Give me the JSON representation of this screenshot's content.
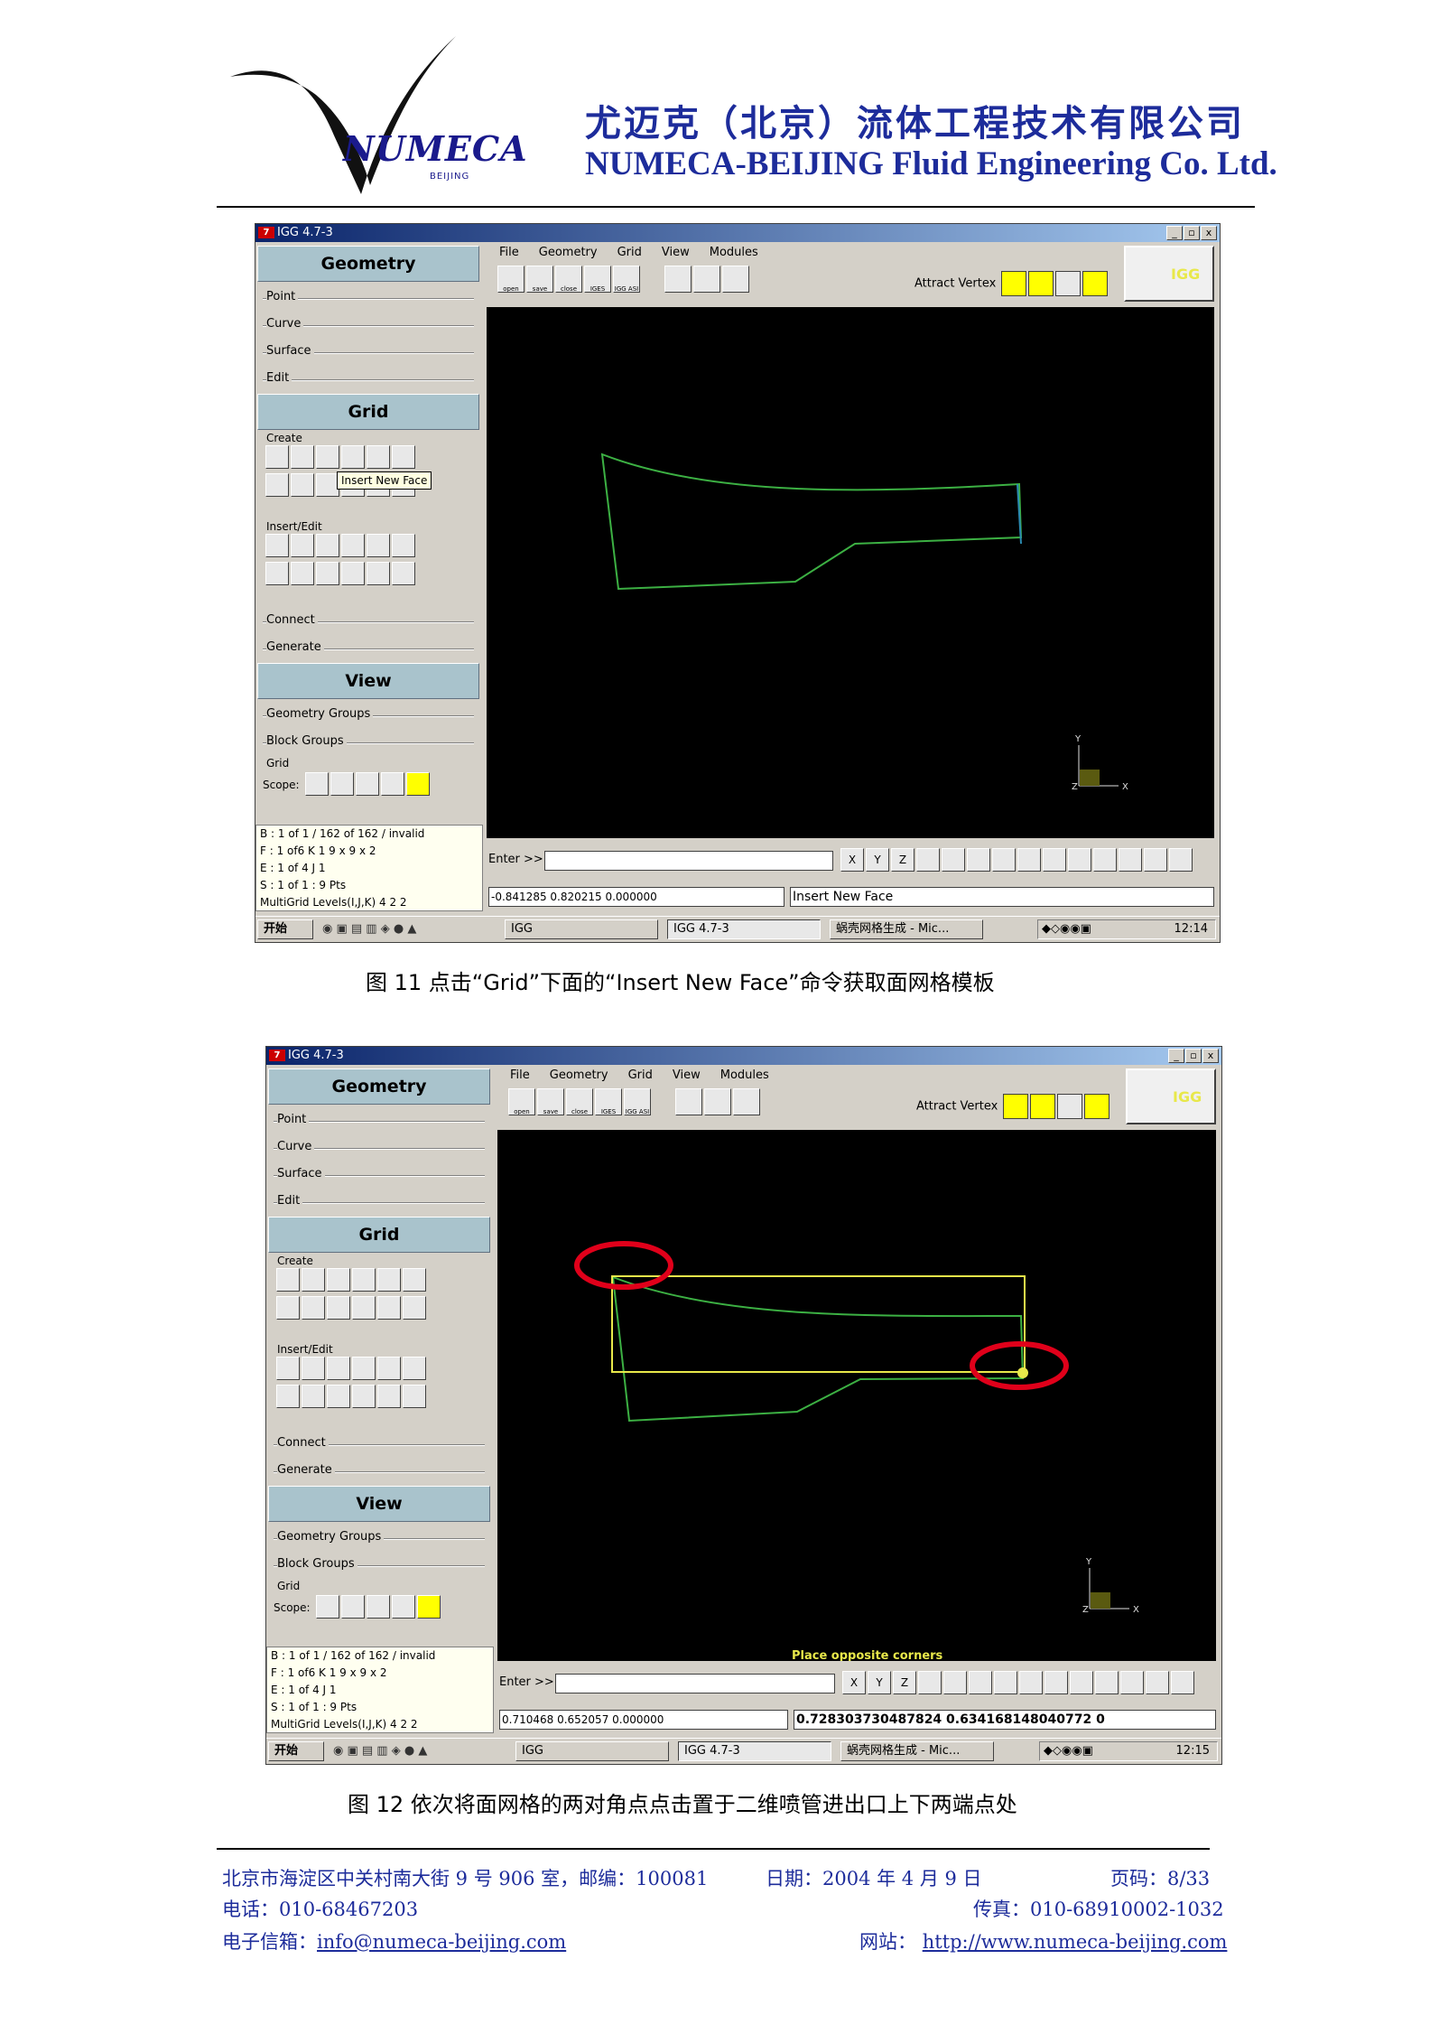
{
  "header": {
    "logo_text": "NUMECA",
    "logo_sub": "BEIJING",
    "company_cn": "尤迈克（北京）流体工程技术有限公司",
    "company_en": "NUMECA-BEIJING Fluid Engineering Co. Ltd."
  },
  "figures": [
    {
      "window_title": "IGG 4.7-3",
      "window_buttons": [
        "_",
        "▫",
        "x"
      ],
      "panel": {
        "geometry_title": "Geometry",
        "geometry_items": [
          "Point",
          "Curve",
          "Surface",
          "Edit"
        ],
        "grid_title": "Grid",
        "create_label": "Create",
        "tooltip": "Insert New Face",
        "insert_label": "Insert/Edit",
        "grid_items": [
          "Connect",
          "Generate"
        ],
        "view_title": "View",
        "view_items": [
          "Geometry Groups",
          "Block Groups"
        ],
        "grid_label": "Grid",
        "scope_label": "Scope:"
      },
      "status_lines": [
        "B : 1 of 1 / 162 of 162 / invalid",
        "F : 1 of6   K   1     9 x 9 x 2",
        "E : 1 of 4    J   1",
        "S : 1 of 1 : 9 Pts",
        "MultiGrid Levels(I,J,K) 4 2 2"
      ],
      "menu": [
        "File",
        "Geometry",
        "Grid",
        "View",
        "Modules"
      ],
      "toolbar": [
        "open",
        "save",
        "close",
        "IGES",
        "IGG ASI"
      ],
      "attract_label": "Attract Vertex",
      "igg_logo": "IGG",
      "viewport_message": "",
      "enter_label": "Enter >>",
      "axis_buttons": [
        "X",
        "Y",
        "Z"
      ],
      "coords": "-0.841285  0.820215  0.000000",
      "message": "Insert New Face",
      "taskbar": {
        "start": "开始",
        "tasks": [
          "IGG",
          "IGG 4.7-3",
          "蜗壳网格生成 - Mic..."
        ],
        "time": "12:14"
      },
      "axis_labels": [
        "Y",
        "Z",
        "X"
      ],
      "caption": "图 11    点击“Grid”下面的“Insert New Face”命令获取面网格模板"
    },
    {
      "window_title": "IGG 4.7-3",
      "window_buttons": [
        "_",
        "▫",
        "x"
      ],
      "panel": {
        "geometry_title": "Geometry",
        "geometry_items": [
          "Point",
          "Curve",
          "Surface",
          "Edit"
        ],
        "grid_title": "Grid",
        "create_label": "Create",
        "tooltip": "",
        "insert_label": "Insert/Edit",
        "grid_items": [
          "Connect",
          "Generate"
        ],
        "view_title": "View",
        "view_items": [
          "Geometry Groups",
          "Block Groups"
        ],
        "grid_label": "Grid",
        "scope_label": "Scope:"
      },
      "status_lines": [
        "B : 1 of 1 / 162 of 162 / invalid",
        "F : 1 of6   K   1     9 x 9 x 2",
        "E : 1 of 4    J   1",
        "S : 1 of 1 : 9 Pts",
        "MultiGrid Levels(I,J,K) 4 2 2"
      ],
      "menu": [
        "File",
        "Geometry",
        "Grid",
        "View",
        "Modules"
      ],
      "toolbar": [
        "open",
        "save",
        "close",
        "IGES",
        "IGG ASI"
      ],
      "attract_label": "Attract Vertex",
      "igg_logo": "IGG",
      "viewport_message": "Place opposite corners",
      "enter_label": "Enter >>",
      "axis_buttons": [
        "X",
        "Y",
        "Z"
      ],
      "coords": "0.710468  0.652057  0.000000",
      "message": "0.728303730487824      0.634168148040772      0",
      "taskbar": {
        "start": "开始",
        "tasks": [
          "IGG",
          "IGG 4.7-3",
          "蜗壳网格生成 - Mic..."
        ],
        "time": "12:15"
      },
      "axis_labels": [
        "Y",
        "Z",
        "X"
      ],
      "caption": "图 12    依次将面网格的两对角点点击置于二维喷管进出口上下两端点处"
    }
  ],
  "footer": {
    "address": "北京市海淀区中关村南大街 9 号 906 室，邮编：100081",
    "date": "日期：2004 年 4 月 9 日",
    "page": "页码：8/33",
    "phone": "电话：010-68467203",
    "fax": "传真：010-68910002-1032",
    "email_label": "电子信箱：",
    "email": "info@numeca-beijing.com",
    "web_label": "网站：",
    "web": "http://www.numeca-beijing.com"
  },
  "colors": {
    "brand_blue": "#1d2c9b",
    "curve_green": "#3cb043",
    "template_yellow": "#e8e84a",
    "highlight_red": "#e0001a",
    "section_header": "#a9c3cc"
  }
}
